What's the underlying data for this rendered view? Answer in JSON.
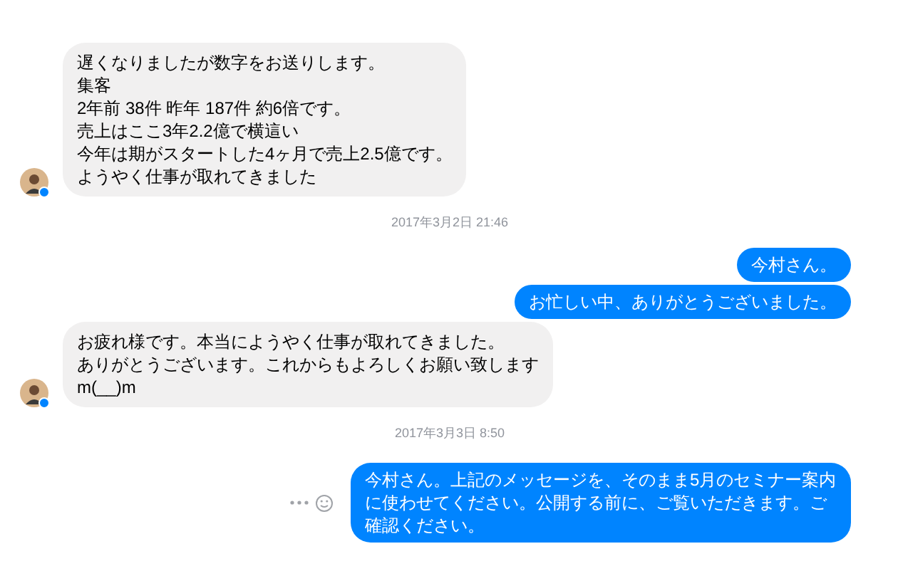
{
  "messages": [
    {
      "kind": "incoming",
      "avatar": true,
      "lines": [
        "遅くなりましたが数字をお送りします。",
        "集客",
        "2年前 38件 昨年  187件  約6倍です。",
        "売上はここ3年2.2億で横這い",
        "今年は期がスタートした4ヶ月で売上2.5億です。",
        "ようやく仕事が取れてきました"
      ]
    },
    {
      "kind": "timestamp",
      "text": "2017年3月2日 21:46"
    },
    {
      "kind": "outgoing",
      "text": "今村さん。"
    },
    {
      "kind": "outgoing",
      "text": "お忙しい中、ありがとうございました。"
    },
    {
      "kind": "incoming",
      "avatar": true,
      "lines": [
        "お疲れ様です。本当にようやく仕事が取れてきました。",
        "ありがとうございます。これからもよろしくお願い致します",
        "m(__)m"
      ]
    },
    {
      "kind": "timestamp",
      "text": "2017年3月3日 8:50"
    },
    {
      "kind": "outgoing",
      "actions": true,
      "text": "今村さん。上記のメッセージを、そのまま5月のセミナー案内に使わせてください。公開する前に、ご覧いただきます。ご確認ください。"
    }
  ]
}
